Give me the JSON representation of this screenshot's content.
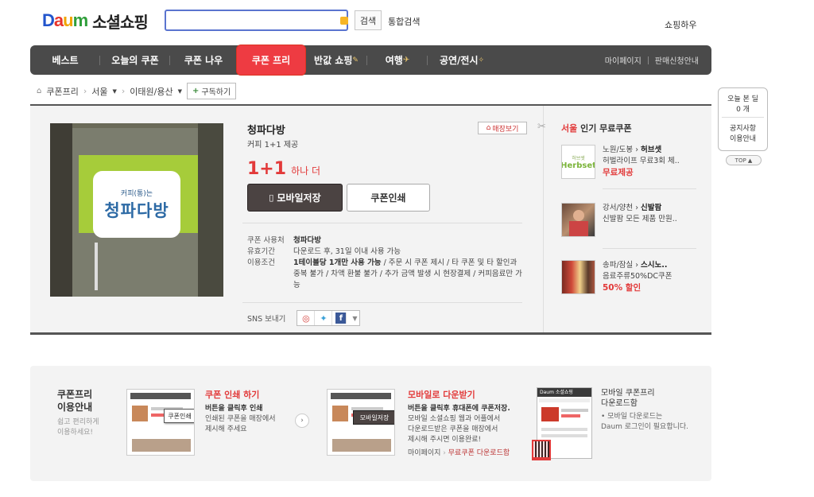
{
  "header": {
    "logo_letters": [
      "D",
      "a",
      "u",
      "m"
    ],
    "site_name": "소셜쇼핑",
    "search_button": "검색",
    "total_search": "통합검색",
    "shop_how": "쇼핑하우"
  },
  "nav": {
    "items": [
      "베스트",
      "오늘의 쿠폰",
      "쿠폰 나우",
      "쿠폰 프리",
      "반값 쇼핑",
      "여행",
      "공연/전시"
    ],
    "active": "쿠폰 프리",
    "right": [
      "마이페이지",
      "판매신청안내"
    ]
  },
  "breadcrumb": {
    "items": [
      "쿠폰프리",
      "서울",
      "이태원/용산"
    ],
    "subscribe": "구독하기"
  },
  "product": {
    "title": "청파다방",
    "subtitle": "커피 1+1 제공",
    "promo_big": "1+1",
    "promo_small": "하나 더",
    "store_button": "매장보기",
    "mobile_save": "모바일저장",
    "coupon_print": "쿠폰인쇄",
    "image_sign": "청파다방",
    "image_sign_small": "커피(통)는",
    "info": [
      {
        "key": "쿠폰 사용처",
        "value": "청파다방"
      },
      {
        "key": "유효기간",
        "value": "다운로드 후, 31일 이내 사용 가능"
      },
      {
        "key": "이용조건",
        "value_bold": "1테이블당 1개만 사용 가능",
        "value": " / 주문 시 쿠폰 제시 / 타 쿠폰 및 타 할인과 중복 불가 / 차액 환불 불가 / 추가 금액 발생 시 현장결제 / 커피음료만 가능"
      }
    ],
    "sns_label": "SNS 보내기"
  },
  "popular": {
    "region": "서울",
    "title": "인기 무료쿠폰",
    "items": [
      {
        "area": "노원/도봉",
        "name": "허브셋",
        "desc": "허벌라이프 무료3회 체..",
        "tag": "무료제공",
        "thumb_text": "Herbset"
      },
      {
        "area": "강서/양천",
        "name": "신발팜",
        "desc": "신발팜 모든 제품 만원..",
        "tag": "",
        "thumb_text": ""
      },
      {
        "area": "송파/잠실",
        "name": "스시노..",
        "desc": "음료주류50%DC쿠폰",
        "tag": "50% 할인",
        "thumb_text": ""
      }
    ]
  },
  "side": {
    "today_label": "오늘 본 딜",
    "today_count": "0 개",
    "notice": "공지사항",
    "guide": "이용안내",
    "top": "TOP"
  },
  "guide": {
    "head_line1": "쿠폰프리",
    "head_line2": "이용안내",
    "sub_line1": "쉽고 편리하게",
    "sub_line2": "이용하세요!",
    "step1": {
      "title": "쿠폰 인쇄 하기",
      "bold": "버튼을 클릭후 인쇄",
      "desc1": "인쇄된 쿠폰을 매장에서",
      "desc2": "제시해 주세요",
      "badge": "쿠폰인쇄"
    },
    "step2": {
      "title": "모바일로 다운받기",
      "bold": "버튼을 클릭후 휴대폰에 쿠폰저장.",
      "desc1": "모바일 소셜쇼핑 웹과 어플에서",
      "desc2": "다운로드받은 쿠폰을 매장에서",
      "desc3": "제시해 주시면 이용완료!",
      "link1": "마이페이지",
      "link2": "무료쿠폰 다운로드함",
      "badge": "모바일저장"
    },
    "step3": {
      "title1": "모바일 쿠폰프리",
      "title2": "다운로드함",
      "desc1": "• 모바일 다운로드는",
      "desc2": "Daum 로그인이 필요합니다."
    }
  },
  "colors": {
    "accent": "#ee3b42",
    "nav_bg": "#4a4a4a",
    "link_blue": "#5a74cf"
  }
}
